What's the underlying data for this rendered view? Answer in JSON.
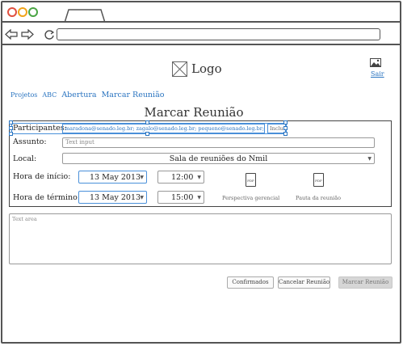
{
  "header": {
    "logo_label": "Logo",
    "logout_label": "Sair"
  },
  "breadcrumb": [
    "Projetos",
    "ABC",
    "Abertura",
    "Marcar Reunião"
  ],
  "page_title": "Marcar Reunião",
  "form": {
    "participants": {
      "label": "Participantes:",
      "value": "maradona@senado.leg.br; zagalo@senado.leg.br; pequeno@senado.leg.br;",
      "add_label": "Inclu"
    },
    "subject": {
      "label": "Assunto:",
      "placeholder": "Text input"
    },
    "location": {
      "label": "Local:",
      "value": "Sala de reuniões do Nmil"
    },
    "start": {
      "label": "Hora de início:",
      "date": "13 May 2013",
      "time": "12:00"
    },
    "end": {
      "label": "Hora de término:",
      "date": "13 May 2013",
      "time": "15:00"
    },
    "attachments": [
      {
        "icon": "pdf-icon",
        "label": "Perspectiva gerencial"
      },
      {
        "icon": "pdf-icon",
        "label": "Pauta da reunião"
      }
    ]
  },
  "textarea": {
    "placeholder": "Text area"
  },
  "buttons": {
    "confirmed": "Confirmados",
    "cancel": "Cancelar Reunião",
    "schedule": "Marcar Reunião"
  }
}
